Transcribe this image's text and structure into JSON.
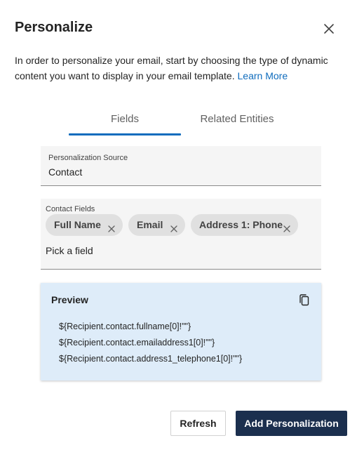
{
  "dialog": {
    "title": "Personalize",
    "description": "In order to personalize your email, start by choosing the type of dynamic content you want to display in your email template. ",
    "learn_more": "Learn More"
  },
  "tabs": [
    {
      "label": "Fields",
      "selected": true
    },
    {
      "label": "Related Entities",
      "selected": false
    }
  ],
  "source": {
    "label": "Personalization Source",
    "value": "Contact"
  },
  "contact_fields": {
    "label": "Contact Fields",
    "chips": [
      {
        "label": "Full Name"
      },
      {
        "label": "Email"
      },
      {
        "label": "Address 1: Phone"
      }
    ],
    "placeholder": "Pick a field"
  },
  "preview": {
    "title": "Preview",
    "lines": [
      "${Recipient.contact.fullname[0]!\"\"}",
      "${Recipient.contact.emailaddress1[0]!\"\"}",
      "${Recipient.contact.address1_telephone1[0]!\"\"}"
    ]
  },
  "footer": {
    "refresh_label": "Refresh",
    "add_label": "Add Personalization"
  },
  "icons": {
    "close": "close-icon",
    "chip_remove": "dismiss-icon",
    "copy": "copy-icon"
  },
  "colors": {
    "accent": "#0f6cbd",
    "primary_button": "#1b2f4e",
    "preview_bg": "#deecf9",
    "field_bg": "#f5f5f5",
    "chip_bg": "#e0e0e0"
  }
}
